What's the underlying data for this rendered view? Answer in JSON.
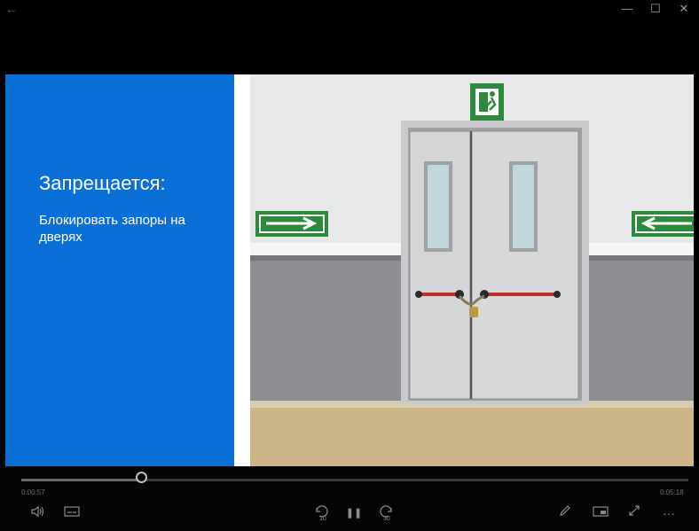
{
  "window": {
    "back_glyph": "←",
    "minimize_glyph": "—",
    "maximize_glyph": "☐",
    "close_glyph": "✕"
  },
  "slide": {
    "heading": "Запрещается:",
    "text": "Блокировать запоры на дверях",
    "panel_color": "#0b6fd8"
  },
  "player": {
    "elapsed": "0:00:57",
    "duration": "0:05:18",
    "progress": 0.179,
    "skip_back_label": "10",
    "skip_forward_label": "30",
    "pause_glyph": "❚❚",
    "more_glyph": "···",
    "icons": [
      "volume-icon",
      "subtitles-icon",
      "skip-back-10-icon",
      "pause-icon",
      "skip-forward-30-icon",
      "pen-icon",
      "mini-view-icon",
      "fullscreen-icon",
      "more-icon"
    ]
  }
}
